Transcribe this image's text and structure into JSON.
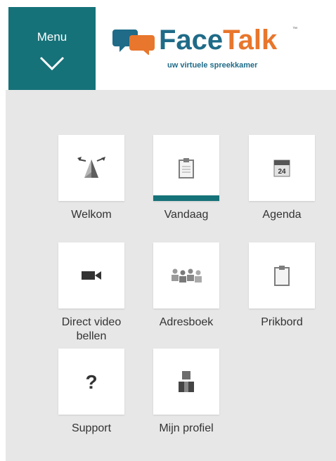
{
  "header": {
    "menu_label": "Menu",
    "logo": {
      "name_part1": "Face",
      "name_part2": "Talk",
      "trademark": "™",
      "tagline": "uw virtuele spreekkamer"
    }
  },
  "tiles": [
    {
      "label": "Welkom",
      "icon": "welcome-icon"
    },
    {
      "label": "Vandaag",
      "icon": "clipboard-icon",
      "active": true
    },
    {
      "label": "Agenda",
      "icon": "calendar-icon",
      "calendar_day": "24"
    },
    {
      "label": "Direct video bellen",
      "icon": "video-camera-icon"
    },
    {
      "label": "Adresboek",
      "icon": "contacts-icon"
    },
    {
      "label": "Prikbord",
      "icon": "clipboard-icon"
    },
    {
      "label": "Support",
      "icon": "question-icon"
    },
    {
      "label": "Mijn profiel",
      "icon": "user-profile-icon"
    }
  ],
  "colors": {
    "accent": "#167279",
    "logo_blue": "#1f6b88",
    "logo_orange": "#e8762c",
    "background": "#e7e7e7"
  }
}
